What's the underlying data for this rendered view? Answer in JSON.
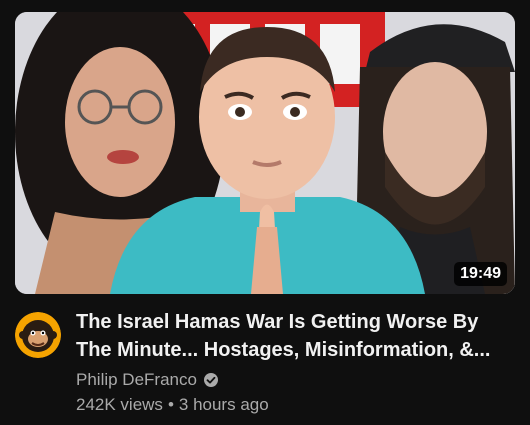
{
  "video": {
    "title": "The Israel Hamas War Is Getting Worse By\nThe Minute... Hostages, Misinformation, &...",
    "duration": "19:49",
    "channel": "Philip DeFranco",
    "views": "242K views",
    "separator": "•",
    "age": "3 hours ago",
    "verified": true
  },
  "icons": {
    "verified": "verified-check-icon",
    "avatar": "channel-avatar-monkey"
  },
  "colors": {
    "background": "#0f0f0f",
    "title": "#f1f1f1",
    "secondary_text": "#aaaaaa",
    "avatar_accent": "#f5a300",
    "thumbnail_red_banner": "#d32222",
    "shirt": "#3dbbc4"
  }
}
